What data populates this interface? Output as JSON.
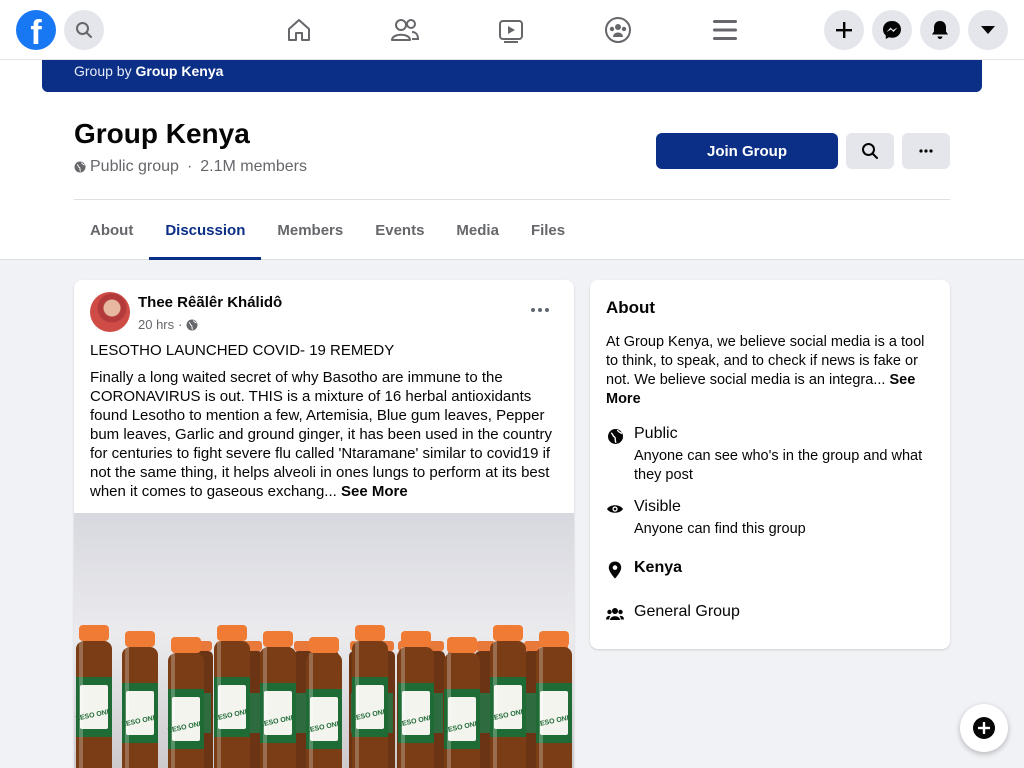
{
  "nav": {
    "logo": "f",
    "icons": [
      "facebook-logo",
      "search-icon",
      "home-icon",
      "friends-icon",
      "watch-icon",
      "groups-icon",
      "menu-icon",
      "plus-icon",
      "messenger-icon",
      "notifications-icon",
      "caret-down-icon"
    ]
  },
  "group": {
    "cover_prefix": "Group by",
    "cover_owner": "Group Kenya",
    "title": "Group Kenya",
    "privacy": "Public group",
    "separator": "·",
    "members": "2.1M members",
    "join_label": "Join Group",
    "tabs": [
      "About",
      "Discussion",
      "Members",
      "Events",
      "Media",
      "Files"
    ],
    "active_tab": "Discussion"
  },
  "post": {
    "author": "Thee Rêãlêr Khálidô",
    "time": "20 hrs",
    "dot": "·",
    "headline": "LESOTHO LAUNCHED COVID- 19 REMEDY",
    "body": "Finally a long waited secret of why Basotho are immune to the CORONAVIRUS is out. THIS is a mixture of 16 herbal antioxidants found Lesotho to mention a few, Artemisia, Blue gum leaves, Pepper bum leaves, Garlic and ground ginger, it has been used in the country for centuries to fight severe flu called 'Ntaramane' similar to covid19 if not the same thing, it helps alveoli in ones lungs to perform at its best when it comes to gaseous exchang...",
    "see_more": "See More",
    "bottle_label": "LESO ONE"
  },
  "about": {
    "heading": "About",
    "description": "At Group Kenya, we believe social media is a tool to think, to speak, and to check if news is fake or not. We believe social media is an integra...",
    "see_more": "See More",
    "public_title": "Public",
    "public_desc": "Anyone can see who's in the group and what they post",
    "visible_title": "Visible",
    "visible_desc": "Anyone can find this group",
    "location": "Kenya",
    "type": "General Group"
  },
  "colors": {
    "brand": "#1877f2",
    "group_accent": "#0b2f86",
    "background": "#f0f2f5"
  }
}
